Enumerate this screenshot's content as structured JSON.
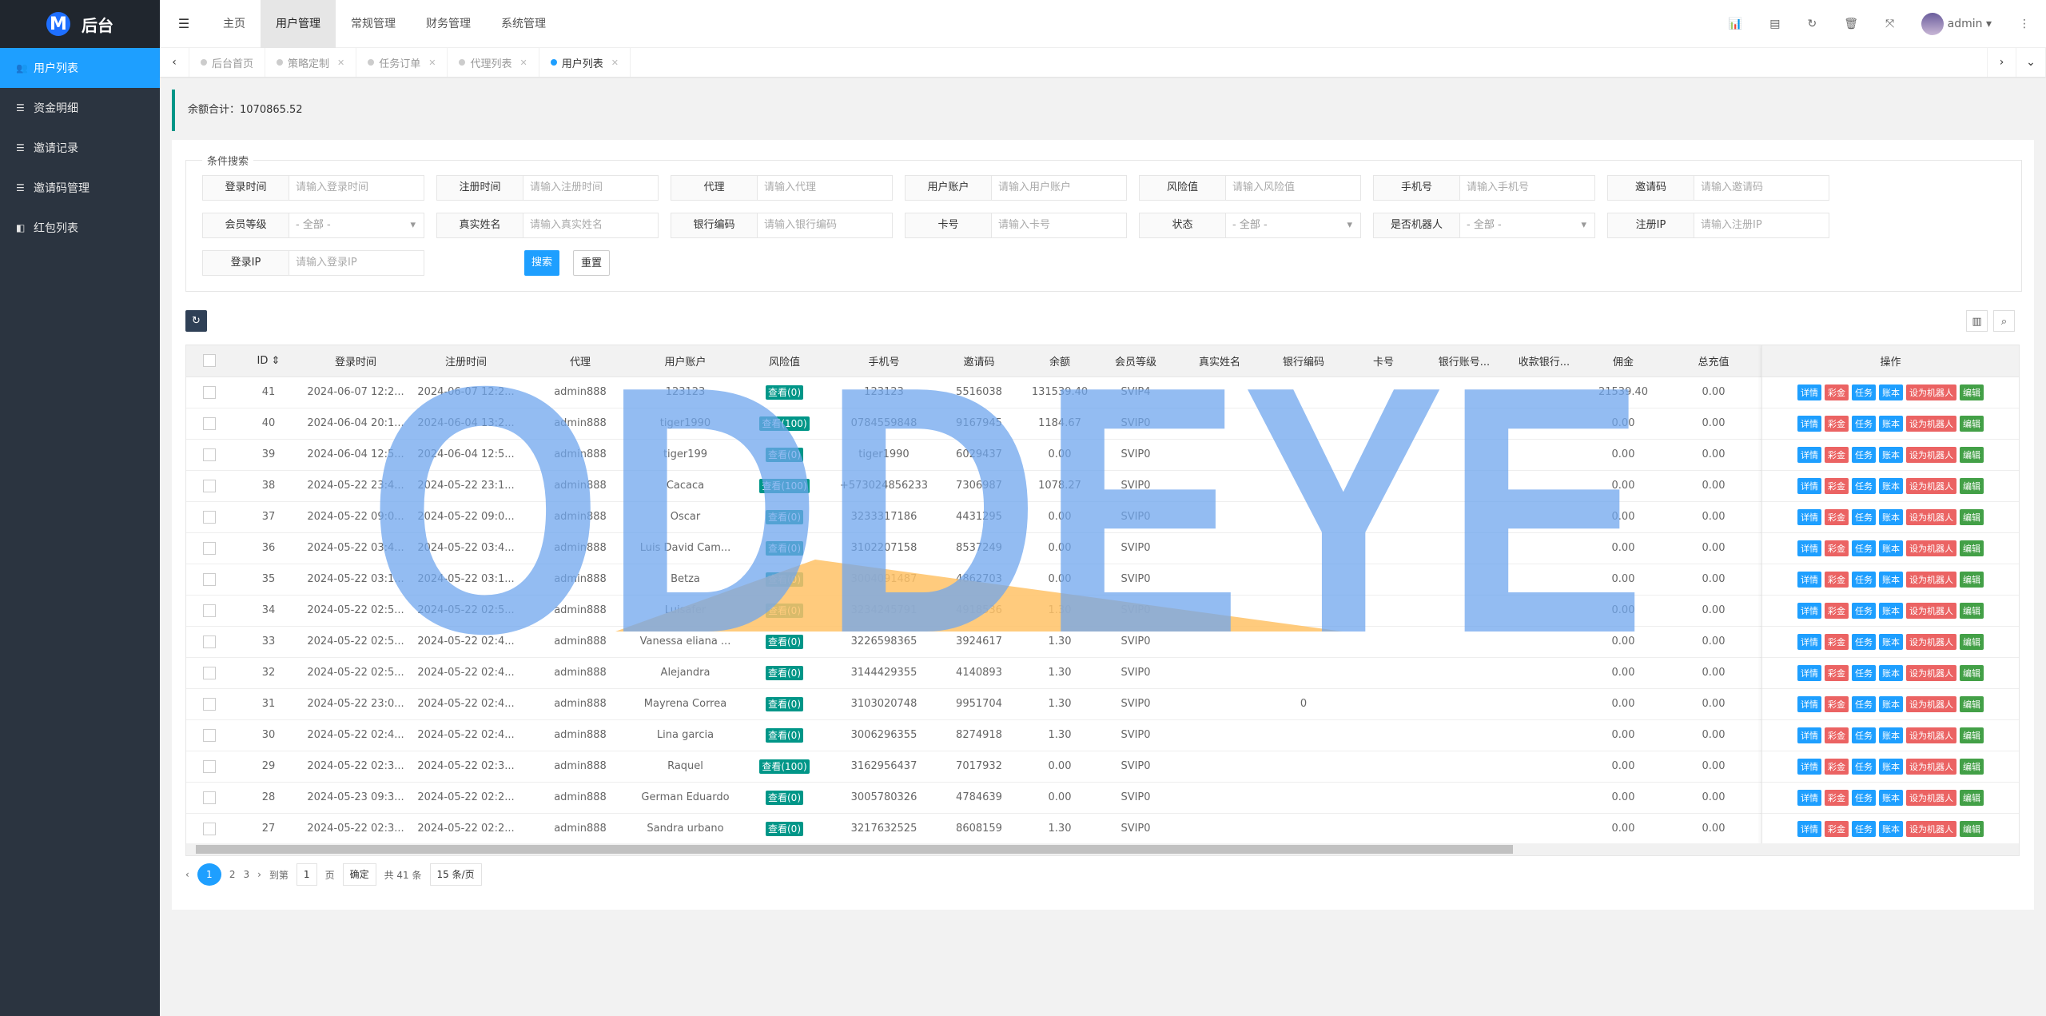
{
  "app": {
    "logo_letter": "M",
    "title": "后台"
  },
  "sidebar": {
    "items": [
      {
        "label": "用户列表",
        "icon": "users-icon",
        "glyph": "👥",
        "active": true
      },
      {
        "label": "资金明细",
        "icon": "list-icon",
        "glyph": "☰"
      },
      {
        "label": "邀请记录",
        "icon": "list-icon",
        "glyph": "☰"
      },
      {
        "label": "邀请码管理",
        "icon": "list-icon",
        "glyph": "☰"
      },
      {
        "label": "红包列表",
        "icon": "redpacket-icon",
        "glyph": "◧"
      }
    ]
  },
  "header": {
    "nav": [
      {
        "label": "主页"
      },
      {
        "label": "用户管理",
        "active": true
      },
      {
        "label": "常规管理"
      },
      {
        "label": "财务管理"
      },
      {
        "label": "系统管理"
      }
    ],
    "user": "admin"
  },
  "tabs": [
    {
      "label": "后台首页",
      "closable": false
    },
    {
      "label": "策略定制",
      "closable": true
    },
    {
      "label": "任务订单",
      "closable": true
    },
    {
      "label": "代理列表",
      "closable": true
    },
    {
      "label": "用户列表",
      "closable": true,
      "active": true
    }
  ],
  "summary": {
    "text": "余额合计：1070865.52"
  },
  "search": {
    "legend": "条件搜索",
    "fields": [
      {
        "label": "登录时间",
        "placeholder": "请输入登录时间"
      },
      {
        "label": "注册时间",
        "placeholder": "请输入注册时间"
      },
      {
        "label": "代理",
        "placeholder": "请输入代理"
      },
      {
        "label": "用户账户",
        "placeholder": "请输入用户账户"
      },
      {
        "label": "风险值",
        "placeholder": "请输入风险值"
      },
      {
        "label": "手机号",
        "placeholder": "请输入手机号"
      },
      {
        "label": "邀请码",
        "placeholder": "请输入邀请码"
      },
      {
        "label": "会员等级",
        "select": "- 全部 -"
      },
      {
        "label": "真实姓名",
        "placeholder": "请输入真实姓名"
      },
      {
        "label": "银行编码",
        "placeholder": "请输入银行编码"
      },
      {
        "label": "卡号",
        "placeholder": "请输入卡号"
      },
      {
        "label": "状态",
        "select": "- 全部 -"
      },
      {
        "label": "是否机器人",
        "select": "- 全部 -"
      },
      {
        "label": "注册IP",
        "placeholder": "请输入注册IP"
      },
      {
        "label": "登录IP",
        "placeholder": "请输入登录IP"
      }
    ],
    "search_label": "搜索",
    "reset_label": "重置"
  },
  "table": {
    "columns": [
      "",
      "ID",
      "登录时间",
      "注册时间",
      "代理",
      "用户账户",
      "风险值",
      "手机号",
      "邀请码",
      "余额",
      "会员等级",
      "真实姓名",
      "银行编码",
      "卡号",
      "银行账号...",
      "收款银行...",
      "佣金",
      "总充值"
    ],
    "ops_header": "操作",
    "actions": [
      {
        "label": "详情",
        "color": "#1E9FFF"
      },
      {
        "label": "彩金",
        "color": "#EB6363"
      },
      {
        "label": "任务",
        "color": "#1E9FFF"
      },
      {
        "label": "账本",
        "color": "#1E9FFF"
      },
      {
        "label": "设为机器人",
        "color": "#EB6363"
      },
      {
        "label": "编辑",
        "color": "#43a047"
      }
    ],
    "rows": [
      [
        "41",
        "2024-06-07 12:2...",
        "2024-06-07 12:2...",
        "admin888",
        "123123",
        "查看(0)",
        "123123",
        "5516038",
        "131539.40",
        "SVIP4",
        "",
        "",
        "",
        "",
        "",
        "21539.40",
        "0.00"
      ],
      [
        "40",
        "2024-06-04 20:1...",
        "2024-06-04 13:2...",
        "admin888",
        "tiger1990",
        "查看(100)",
        "0784559848",
        "9167945",
        "1184.67",
        "SVIP0",
        "",
        "",
        "",
        "",
        "",
        "0.00",
        "0.00"
      ],
      [
        "39",
        "2024-06-04 12:5...",
        "2024-06-04 12:5...",
        "admin888",
        "tiger199",
        "查看(0)",
        "tiger1990",
        "6029437",
        "0.00",
        "SVIP0",
        "",
        "",
        "",
        "",
        "",
        "0.00",
        "0.00"
      ],
      [
        "38",
        "2024-05-22 23:4...",
        "2024-05-22 23:1...",
        "admin888",
        "Cacaca",
        "查看(100)",
        "+573024856233",
        "7306987",
        "1078.27",
        "SVIP0",
        "",
        "",
        "",
        "",
        "",
        "0.00",
        "0.00"
      ],
      [
        "37",
        "2024-05-22 09:0...",
        "2024-05-22 09:0...",
        "admin888",
        "Oscar",
        "查看(0)",
        "3233317186",
        "4431295",
        "0.00",
        "SVIP0",
        "",
        "",
        "",
        "",
        "",
        "0.00",
        "0.00"
      ],
      [
        "36",
        "2024-05-22 03:4...",
        "2024-05-22 03:4...",
        "admin888",
        "Luis David Cam...",
        "查看(0)",
        "3102207158",
        "8537249",
        "0.00",
        "SVIP0",
        "",
        "",
        "",
        "",
        "",
        "0.00",
        "0.00"
      ],
      [
        "35",
        "2024-05-22 03:1...",
        "2024-05-22 03:1...",
        "admin888",
        "Betza",
        "查看(0)",
        "3004091487",
        "4862703",
        "0.00",
        "SVIP0",
        "",
        "",
        "",
        "",
        "",
        "0.00",
        "0.00"
      ],
      [
        "34",
        "2024-05-22 02:5...",
        "2024-05-22 02:5...",
        "admin888",
        "Luisafer",
        "查看(0)",
        "3234245791",
        "4918536",
        "1.30",
        "SVIP0",
        "",
        "",
        "",
        "",
        "",
        "0.00",
        "0.00"
      ],
      [
        "33",
        "2024-05-22 02:5...",
        "2024-05-22 02:4...",
        "admin888",
        "Vanessa eliana ...",
        "查看(0)",
        "3226598365",
        "3924617",
        "1.30",
        "SVIP0",
        "",
        "",
        "",
        "",
        "",
        "0.00",
        "0.00"
      ],
      [
        "32",
        "2024-05-22 02:5...",
        "2024-05-22 02:4...",
        "admin888",
        "Alejandra",
        "查看(0)",
        "3144429355",
        "4140893",
        "1.30",
        "SVIP0",
        "",
        "",
        "",
        "",
        "",
        "0.00",
        "0.00"
      ],
      [
        "31",
        "2024-05-22 23:0...",
        "2024-05-22 02:4...",
        "admin888",
        "Mayrena Correa",
        "查看(0)",
        "3103020748",
        "9951704",
        "1.30",
        "SVIP0",
        "",
        "0",
        "",
        "",
        "",
        "0.00",
        "0.00"
      ],
      [
        "30",
        "2024-05-22 02:4...",
        "2024-05-22 02:4...",
        "admin888",
        "Lina garcia",
        "查看(0)",
        "3006296355",
        "8274918",
        "1.30",
        "SVIP0",
        "",
        "",
        "",
        "",
        "",
        "0.00",
        "0.00"
      ],
      [
        "29",
        "2024-05-22 02:3...",
        "2024-05-22 02:3...",
        "admin888",
        "Raquel",
        "查看(100)",
        "3162956437",
        "7017932",
        "0.00",
        "SVIP0",
        "",
        "",
        "",
        "",
        "",
        "0.00",
        "0.00"
      ],
      [
        "28",
        "2024-05-23 09:3...",
        "2024-05-22 02:2...",
        "admin888",
        "German Eduardo",
        "查看(0)",
        "3005780326",
        "4784639",
        "0.00",
        "SVIP0",
        "",
        "",
        "",
        "",
        "",
        "0.00",
        "0.00"
      ],
      [
        "27",
        "2024-05-22 02:3...",
        "2024-05-22 02:2...",
        "admin888",
        "Sandra urbano",
        "查看(0)",
        "3217632525",
        "8608159",
        "1.30",
        "SVIP0",
        "",
        "",
        "",
        "",
        "",
        "0.00",
        "0.00"
      ]
    ]
  },
  "pager": {
    "pages": [
      "1",
      "2",
      "3"
    ],
    "current": "1",
    "goto_label": "到第",
    "goto_value": "1",
    "page_unit": "页",
    "confirm": "确定",
    "total": "共 41 条",
    "per_page": "15 条/页"
  },
  "watermark": {
    "text": "ODDEYE",
    "color": "#6fa6ee",
    "accent": "#ffc266"
  },
  "colors": {
    "primary": "#1E9FFF",
    "teal": "#009688",
    "sidebar": "#2b3440"
  }
}
